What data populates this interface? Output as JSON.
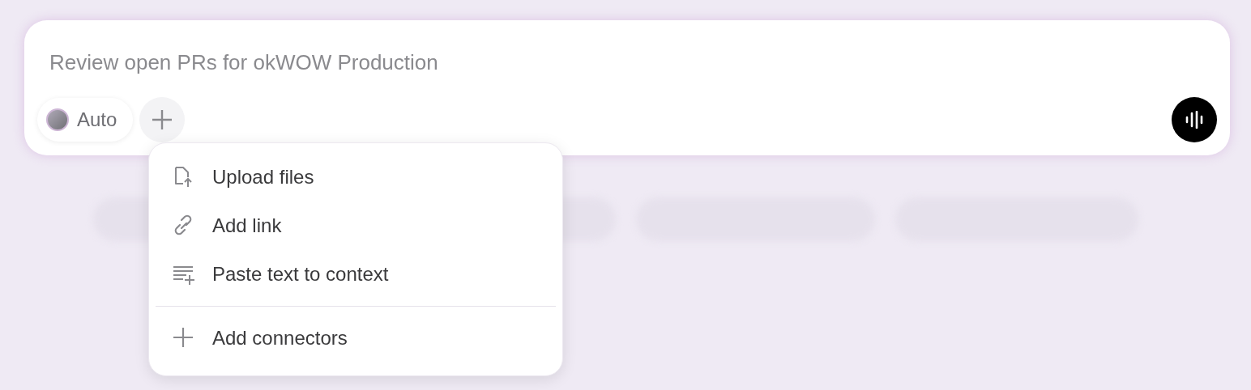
{
  "prompt": {
    "placeholder": "Review open PRs for okWOW Production"
  },
  "model_chip": {
    "label": "Auto"
  },
  "attach_menu": {
    "groups": [
      [
        {
          "label": "Upload files"
        },
        {
          "label": "Add link"
        },
        {
          "label": "Paste text to context"
        }
      ],
      [
        {
          "label": "Add connectors"
        }
      ]
    ]
  }
}
